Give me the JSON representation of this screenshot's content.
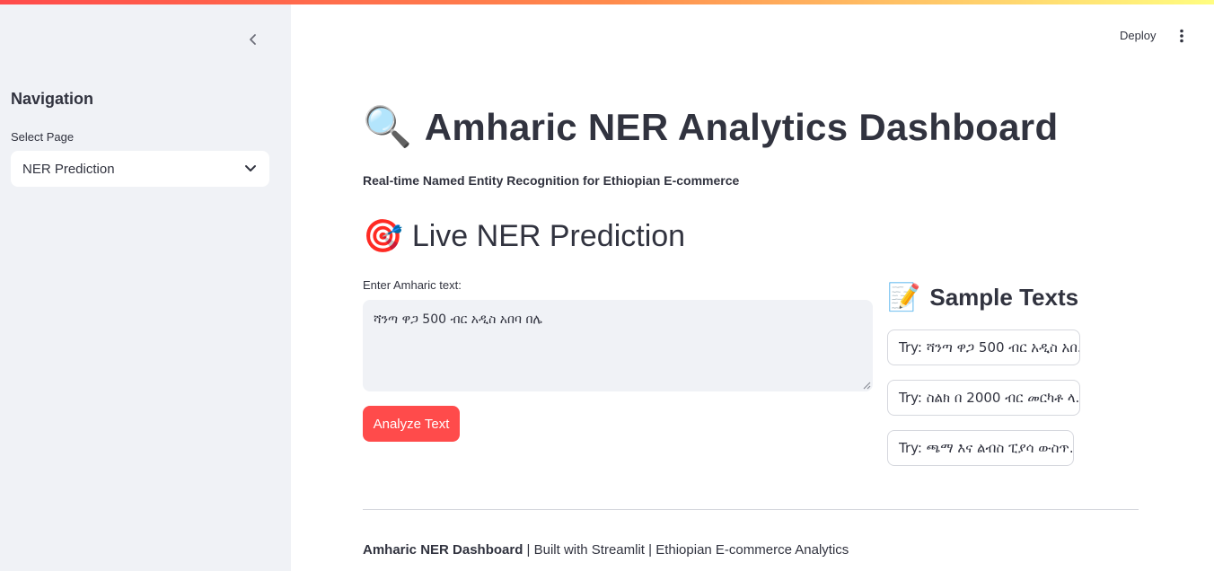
{
  "header": {
    "deploy_label": "Deploy",
    "more_icon": "vertical-dots-icon",
    "accent_gradient": [
      "#ff4b4b",
      "#ff8a4c",
      "#fffd80"
    ]
  },
  "sidebar": {
    "collapse_icon": "chevron-left-icon",
    "title": "Navigation",
    "select_label": "Select Page",
    "select_value": "NER Prediction",
    "background": "#f0f2f6"
  },
  "main": {
    "title_emoji": "🔍",
    "title": "Amharic NER Analytics Dashboard",
    "subtitle": "Real-time Named Entity Recognition for Ethiopian E-commerce",
    "section_emoji": "🎯",
    "section_title": "Live NER Prediction",
    "input_label": "Enter Amharic text:",
    "input_value": "ሻንጣ ዋጋ 500 ብር አዲስ አበባ በሌ",
    "analyze_label": "Analyze Text",
    "button_color": "#ff4b4b"
  },
  "samples": {
    "emoji": "📝",
    "title": "Sample Texts",
    "items": [
      "Try: ሻንጣ ዋጋ 500 ብር አዲስ አበ...",
      "Try: ስልክ በ 2000 ብር መርካቶ ላ...",
      "Try: ጫማ እና ልብስ ፒያሳ ውስጥ..."
    ]
  },
  "footer": {
    "bold": "Amharic NER Dashboard",
    "rest": " | Built with Streamlit | Ethiopian E-commerce Analytics"
  }
}
